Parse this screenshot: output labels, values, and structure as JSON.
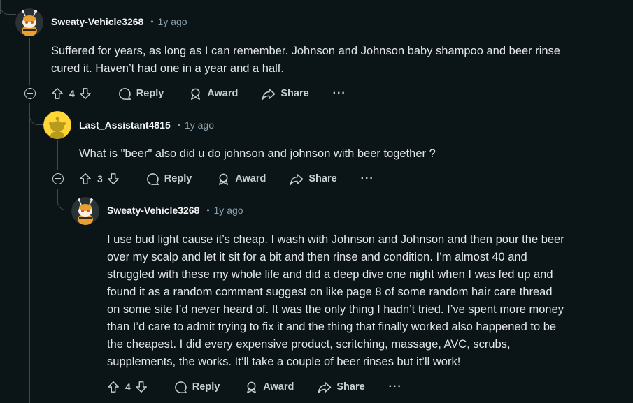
{
  "comments": [
    {
      "author": "Sweaty-Vehicle3268",
      "age": "1y ago",
      "body": "Suffered for years, as long as I can remember. Johnson and Johnson baby shampoo and beer rinse\ncured it. Haven’t had one in a year and a half.",
      "score": "4",
      "actions": {
        "reply": "Reply",
        "award": "Award",
        "share": "Share",
        "more": "···"
      }
    },
    {
      "author": "Last_Assistant4815",
      "age": "1y ago",
      "body": "What is \"beer\" also did u do johnson and johnson with beer together ?",
      "score": "3",
      "actions": {
        "reply": "Reply",
        "award": "Award",
        "share": "Share",
        "more": "···"
      }
    },
    {
      "author": "Sweaty-Vehicle3268",
      "age": "1y ago",
      "body": "I use bud light cause it’s cheap. I wash with Johnson and Johnson and then pour the beer\nover my scalp and let it sit for a bit and then rinse and condition. I’m almost 40 and\nstruggled with these my whole life and did a deep dive one night when I was fed up and\nfound it as a random comment suggest on like page 8 of some random hair care thread\non some site I’d never heard of. It was the only thing I hadn’t tried. I’ve spent more money\nthan I’d care to admit trying to fix it and the thing that finally worked also happened to be\nthe cheapest. I did every expensive product, scritching, massage, AVC, scrubs,\nsupplements, the works. It’ll take a couple of beer rinses but it’ll work!",
      "score": "4",
      "actions": {
        "reply": "Reply",
        "award": "Award",
        "share": "Share",
        "more": "···"
      }
    }
  ],
  "colors": {
    "background": "#0b1416",
    "text": "#e4e7e8",
    "muted": "#8ba2ad",
    "thread_line": "#3e4a4f",
    "avatar_yellow": "#ffd635"
  },
  "icons": [
    "snoo-bee-avatar",
    "snoo-default-avatar",
    "upvote-icon",
    "downvote-icon",
    "comment-icon",
    "award-icon",
    "share-icon",
    "collapse-icon"
  ]
}
